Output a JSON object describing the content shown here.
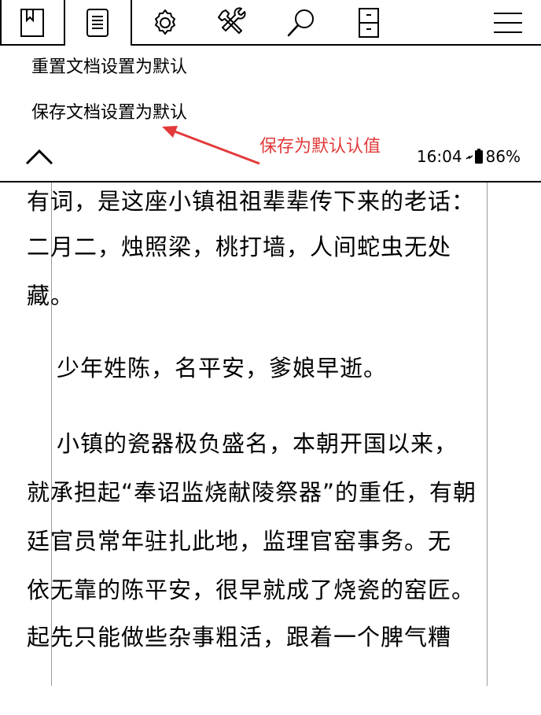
{
  "toolbar": {
    "tabs": [
      {
        "icon": "bookmark-icon"
      },
      {
        "icon": "document-list-icon"
      },
      {
        "icon": "gear-icon"
      },
      {
        "icon": "tools-icon"
      },
      {
        "icon": "search-icon"
      },
      {
        "icon": "cabinet-icon"
      },
      {
        "icon": "hamburger-menu-icon"
      }
    ]
  },
  "menu": {
    "items": [
      {
        "label": "重置文档设置为默认"
      },
      {
        "label": "保存文档设置为默认"
      }
    ],
    "collapse_icon": "chevron-up-icon"
  },
  "annotation": {
    "text": "保存为默认认值",
    "color": "#e23a3a"
  },
  "status": {
    "time": "16:04",
    "battery": "86%"
  },
  "reader": {
    "lines": [
      "有词，是这座小镇祖祖辈辈传下来的老话：",
      "二月二，烛照梁，桃打墙，人间蛇虫无处",
      "藏。",
      "少年姓陈，名平安，爹娘早逝。",
      "小镇的瓷器极负盛名，本朝开国以来，",
      "就承担起“奉诏监烧献陵祭器”的重任，有朝",
      "廷官员常年驻扎此地，监理官窑事务。无",
      "依无靠的陈平安，很早就成了烧瓷的窑匠。",
      "起先只能做些杂事粗活，跟着一个脾气糟"
    ]
  }
}
